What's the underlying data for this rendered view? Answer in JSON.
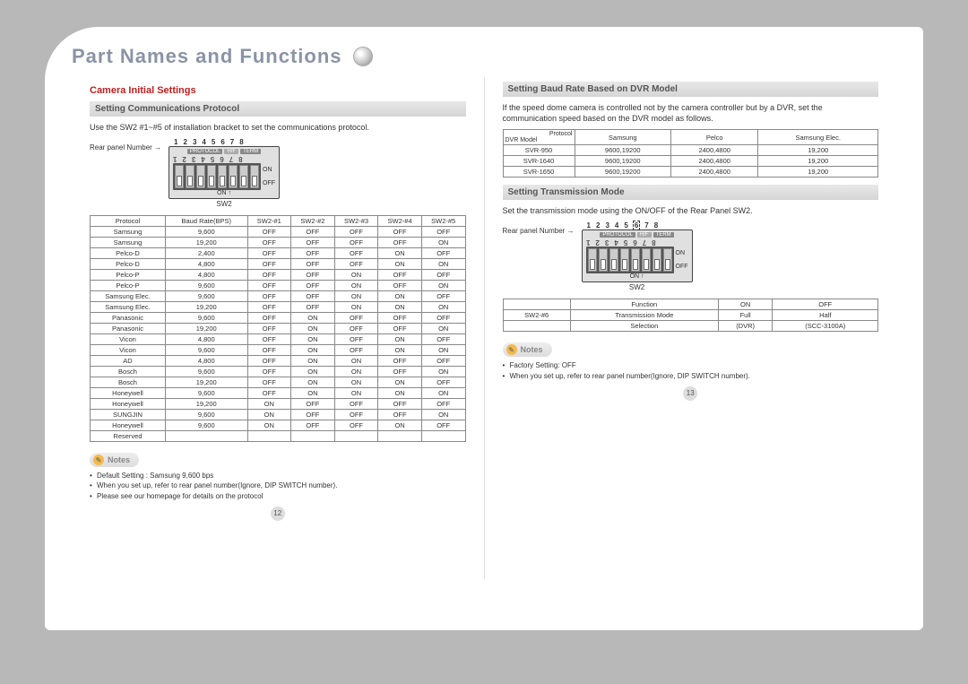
{
  "title": "Part Names and Functions",
  "left": {
    "h1": "Camera Initial Settings",
    "sub1": "Setting Communications Protocol",
    "intro": "Use the SW2 #1~#5 of installation bracket to set the communications protocol.",
    "rear_label": "Rear panel Number",
    "dip": {
      "top": [
        "1",
        "2",
        "3",
        "4",
        "5",
        "6",
        "7",
        "8"
      ],
      "strip": [
        "PROTOCOL",
        "H/F",
        "TERM"
      ],
      "on": "ON",
      "off": "OFF",
      "caption": "SW2",
      "arrow": "ON ↑"
    },
    "table_headers": [
      "Protocol",
      "Baud Rate(BPS)",
      "SW2-#1",
      "SW2-#2",
      "SW2-#3",
      "SW2-#4",
      "SW2-#5"
    ],
    "table_rows": [
      [
        "Samsung",
        "9,600",
        "OFF",
        "OFF",
        "OFF",
        "OFF",
        "OFF"
      ],
      [
        "Samsung",
        "19,200",
        "OFF",
        "OFF",
        "OFF",
        "OFF",
        "ON"
      ],
      [
        "Pelco-D",
        "2,400",
        "OFF",
        "OFF",
        "OFF",
        "ON",
        "OFF"
      ],
      [
        "Pelco-D",
        "4,800",
        "OFF",
        "OFF",
        "OFF",
        "ON",
        "ON"
      ],
      [
        "Pelco-P",
        "4,800",
        "OFF",
        "OFF",
        "ON",
        "OFF",
        "OFF"
      ],
      [
        "Pelco-P",
        "9,600",
        "OFF",
        "OFF",
        "ON",
        "OFF",
        "ON"
      ],
      [
        "Samsung Elec.",
        "9,600",
        "OFF",
        "OFF",
        "ON",
        "ON",
        "OFF"
      ],
      [
        "Samsung Elec.",
        "19,200",
        "OFF",
        "OFF",
        "ON",
        "ON",
        "ON"
      ],
      [
        "Panasonic",
        "9,600",
        "OFF",
        "ON",
        "OFF",
        "OFF",
        "OFF"
      ],
      [
        "Panasonic",
        "19,200",
        "OFF",
        "ON",
        "OFF",
        "OFF",
        "ON"
      ],
      [
        "Vicon",
        "4,800",
        "OFF",
        "ON",
        "OFF",
        "ON",
        "OFF"
      ],
      [
        "Vicon",
        "9,600",
        "OFF",
        "ON",
        "OFF",
        "ON",
        "ON"
      ],
      [
        "AD",
        "4,800",
        "OFF",
        "ON",
        "ON",
        "OFF",
        "OFF"
      ],
      [
        "Bosch",
        "9,600",
        "OFF",
        "ON",
        "ON",
        "OFF",
        "ON"
      ],
      [
        "Bosch",
        "19,200",
        "OFF",
        "ON",
        "ON",
        "ON",
        "OFF"
      ],
      [
        "Honeywell",
        "9,600",
        "OFF",
        "ON",
        "ON",
        "ON",
        "ON"
      ],
      [
        "Honeywell",
        "19,200",
        "ON",
        "OFF",
        "OFF",
        "OFF",
        "OFF"
      ],
      [
        "SUNGJIN",
        "9,600",
        "ON",
        "OFF",
        "OFF",
        "OFF",
        "ON"
      ],
      [
        "Honeywell",
        "9,600",
        "ON",
        "OFF",
        "OFF",
        "ON",
        "OFF"
      ],
      [
        "Reserved",
        "",
        "",
        "",
        "",
        "",
        ""
      ]
    ],
    "notes_h": "Notes",
    "notes": [
      "Default Setting : Samsung 9,600 bps",
      "When you set up, refer to rear panel number(Ignore, DIP SWITCH number).",
      "Please see our homepage for details on the protocol"
    ],
    "page": "12"
  },
  "right": {
    "sub1": "Setting Baud Rate Based on DVR Model",
    "intro": "If the speed dome camera is controlled not by the camera controller but by a DVR, set the communication speed based on the DVR model as follows.",
    "dvr_diag_tl": "Protocol",
    "dvr_diag_bl": "DVR Model",
    "dvr_cols": [
      "Samsung",
      "Pelco",
      "Samsung Elec."
    ],
    "dvr_rows": [
      [
        "SVR-950",
        "9600,19200",
        "2400,4800",
        "19,200"
      ],
      [
        "SVR-1640",
        "9600,19200",
        "2400,4800",
        "19,200"
      ],
      [
        "SVR-1650",
        "9600,19200",
        "2400,4800",
        "19,200"
      ]
    ],
    "sub2": "Setting Transmission Mode",
    "intro2": "Set the transmission mode using the ON/OFF of the Rear Panel SW2.",
    "rear_label": "Rear panel Number",
    "dip": {
      "top": [
        "1",
        "2",
        "3",
        "4",
        "5",
        "6",
        "7",
        "8"
      ],
      "strip": [
        "PROTOCOL",
        "H/F",
        "TERM"
      ],
      "on": "ON",
      "off": "OFF",
      "caption": "SW2",
      "arrow": "ON ↑"
    },
    "tm_headers": [
      "",
      "Function",
      "ON",
      "OFF"
    ],
    "tm_rows": [
      [
        "SW2-#6",
        "Transmission Mode",
        "Full",
        "Half"
      ],
      [
        "",
        "Selection",
        "(DVR)",
        "(SCC-3100A)"
      ]
    ],
    "notes_h": "Notes",
    "notes": [
      "Factory Setting: OFF",
      "When you set up, refer to rear panel number(Ignore, DIP SWITCH number)."
    ],
    "page": "13"
  }
}
